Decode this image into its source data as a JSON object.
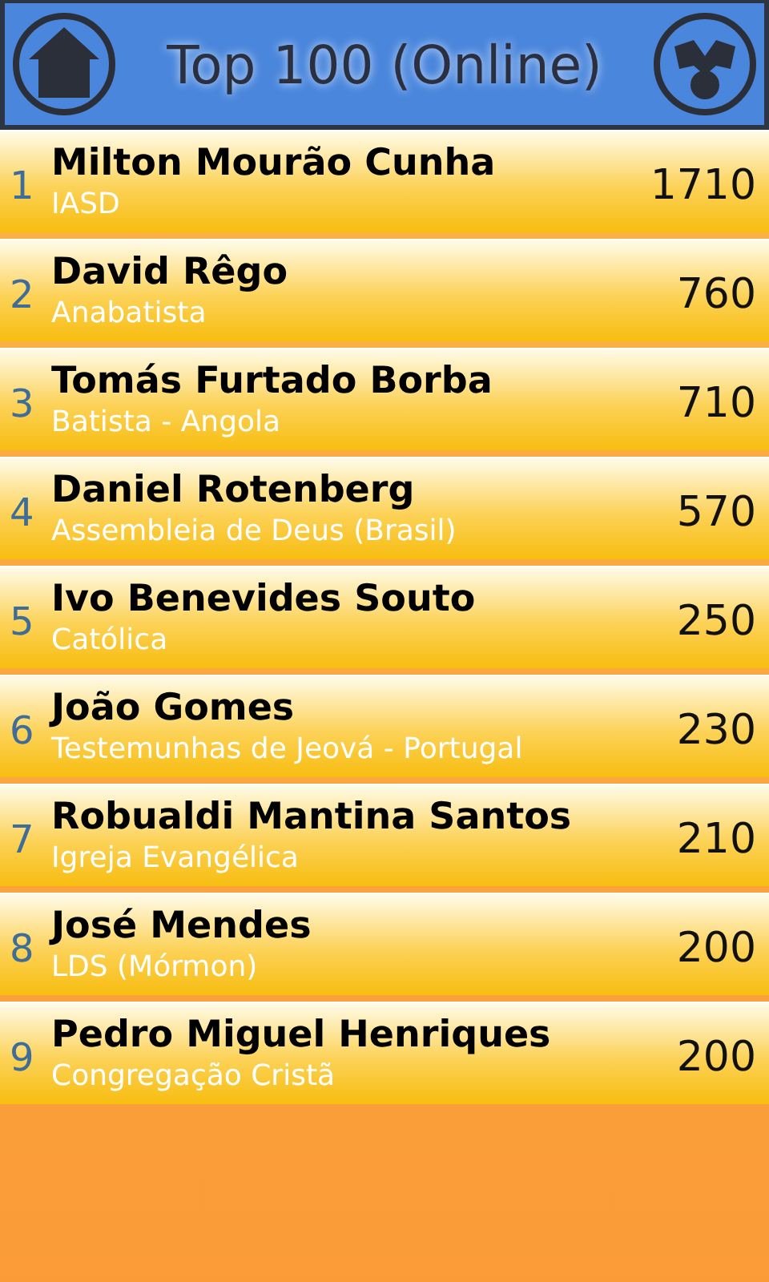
{
  "header": {
    "title": "Top 100 (Online)"
  },
  "rows": [
    {
      "rank": "1",
      "name": "Milton Mourão Cunha",
      "group": "IASD",
      "score": "1710"
    },
    {
      "rank": "2",
      "name": "David Rêgo",
      "group": "Anabatista",
      "score": "760"
    },
    {
      "rank": "3",
      "name": "Tomás Furtado Borba",
      "group": "Batista - Angola",
      "score": "710"
    },
    {
      "rank": "4",
      "name": "Daniel Rotenberg",
      "group": "Assembleia de Deus (Brasil)",
      "score": "570"
    },
    {
      "rank": "5",
      "name": "Ivo Benevides Souto",
      "group": "Católica",
      "score": "250"
    },
    {
      "rank": "6",
      "name": "João Gomes",
      "group": "Testemunhas de Jeová - Portugal",
      "score": "230"
    },
    {
      "rank": "7",
      "name": "Robualdi Mantina Santos",
      "group": "Igreja Evangélica",
      "score": "210"
    },
    {
      "rank": "8",
      "name": "José Mendes",
      "group": "LDS (Mórmon)",
      "score": "200"
    },
    {
      "rank": "9",
      "name": "Pedro Miguel Henriques",
      "group": "Congregação Cristã",
      "score": "200"
    }
  ]
}
